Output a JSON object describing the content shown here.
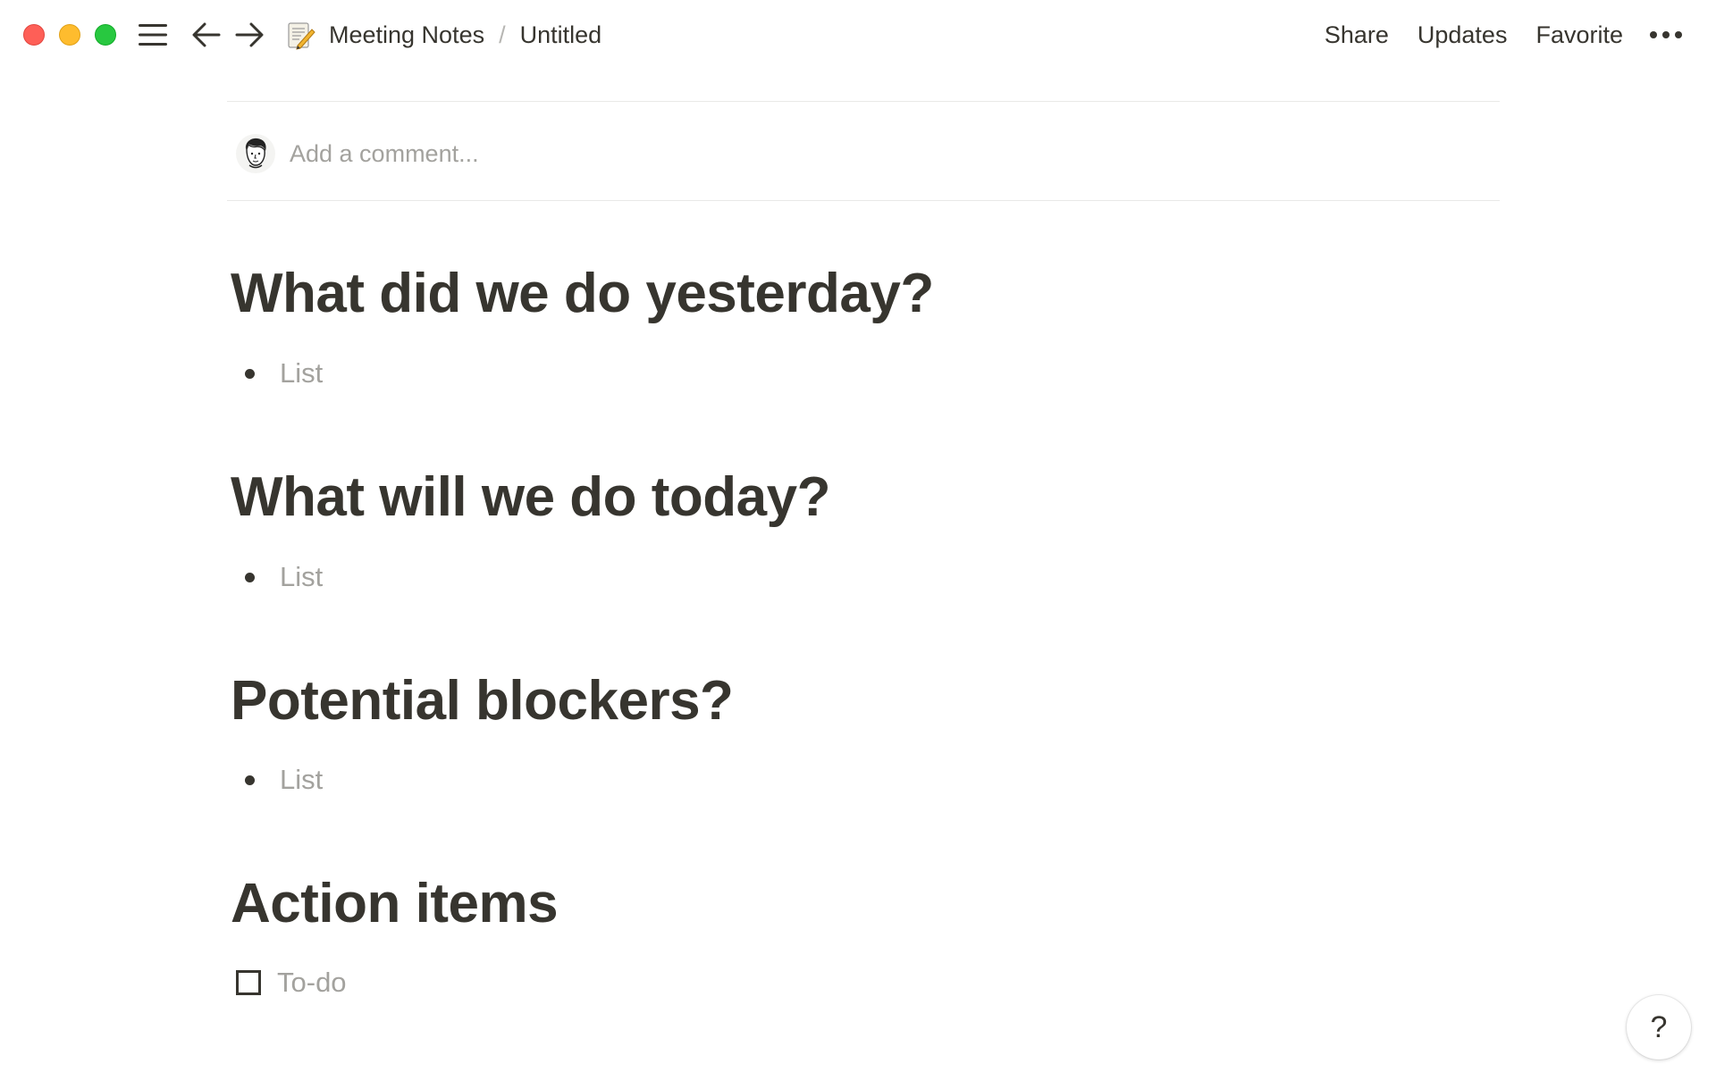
{
  "window": {
    "controls": [
      "close",
      "minimize",
      "maximize"
    ]
  },
  "toolbar": {
    "menu_icon": "hamburger-menu-icon",
    "back_icon": "arrow-left-icon",
    "forward_icon": "arrow-right-icon"
  },
  "breadcrumb": {
    "emoji_icon": "memo-icon",
    "parent": "Meeting Notes",
    "separator": "/",
    "current": "Untitled"
  },
  "actions": {
    "share": "Share",
    "updates": "Updates",
    "favorite": "Favorite",
    "more_icon": "ellipsis-icon"
  },
  "comment": {
    "placeholder": "Add a comment...",
    "value": ""
  },
  "sections": [
    {
      "heading": "What did we do yesterday?",
      "item_type": "bullet",
      "item_placeholder": "List"
    },
    {
      "heading": "What will we do today?",
      "item_type": "bullet",
      "item_placeholder": "List"
    },
    {
      "heading": "Potential blockers?",
      "item_type": "bullet",
      "item_placeholder": "List"
    },
    {
      "heading": "Action items",
      "item_type": "todo",
      "item_placeholder": "To-do",
      "checked": false
    }
  ],
  "help": {
    "label": "?"
  },
  "colors": {
    "text": "#37352f",
    "placeholder": "#a3a29e",
    "divider": "#e9e9e7",
    "close": "#fe5f57",
    "minimize": "#febc2e",
    "maximize": "#28c840"
  }
}
